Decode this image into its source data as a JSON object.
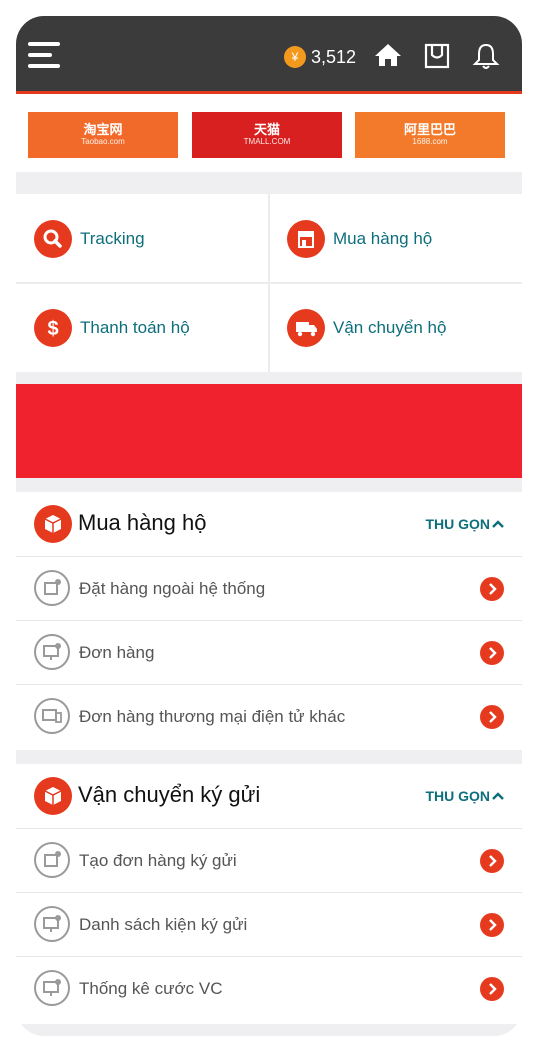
{
  "header": {
    "coin_symbol": "¥",
    "balance": "3,512"
  },
  "logos": [
    {
      "name": "淘宝网",
      "sub": "Taobao.com"
    },
    {
      "name": "天猫",
      "sub": "TMALL.COM"
    },
    {
      "name": "阿里巴巴",
      "sub": "1688.com"
    }
  ],
  "services": [
    {
      "label": "Tracking",
      "icon": "search-icon"
    },
    {
      "label": "Mua hàng hộ",
      "icon": "store-icon"
    },
    {
      "label": "Thanh toán hộ",
      "icon": "dollar-icon"
    },
    {
      "label": "Vận chuyển hộ",
      "icon": "truck-icon"
    }
  ],
  "sections": [
    {
      "title": "Mua hàng hộ",
      "collapse_label": "THU GỌN",
      "items": [
        {
          "label": "Đặt hàng ngoài hệ thống",
          "icon": "box-icon"
        },
        {
          "label": "Đơn hàng",
          "icon": "monitor-icon"
        },
        {
          "label": "Đơn hàng thương mại điện tử khác",
          "icon": "devices-icon"
        }
      ]
    },
    {
      "title": "Vận chuyển ký gửi",
      "collapse_label": "THU GỌN",
      "items": [
        {
          "label": "Tạo đơn hàng ký gửi",
          "icon": "box-icon"
        },
        {
          "label": "Danh sách kiện ký gửi",
          "icon": "monitor-icon"
        },
        {
          "label": "Thống kê cước VC",
          "icon": "monitor-icon"
        }
      ]
    }
  ],
  "colors": {
    "accent": "#e63a1f",
    "teal": "#0d6e7c",
    "header_bg": "#3b3b3b",
    "banner": "#f0222d"
  }
}
